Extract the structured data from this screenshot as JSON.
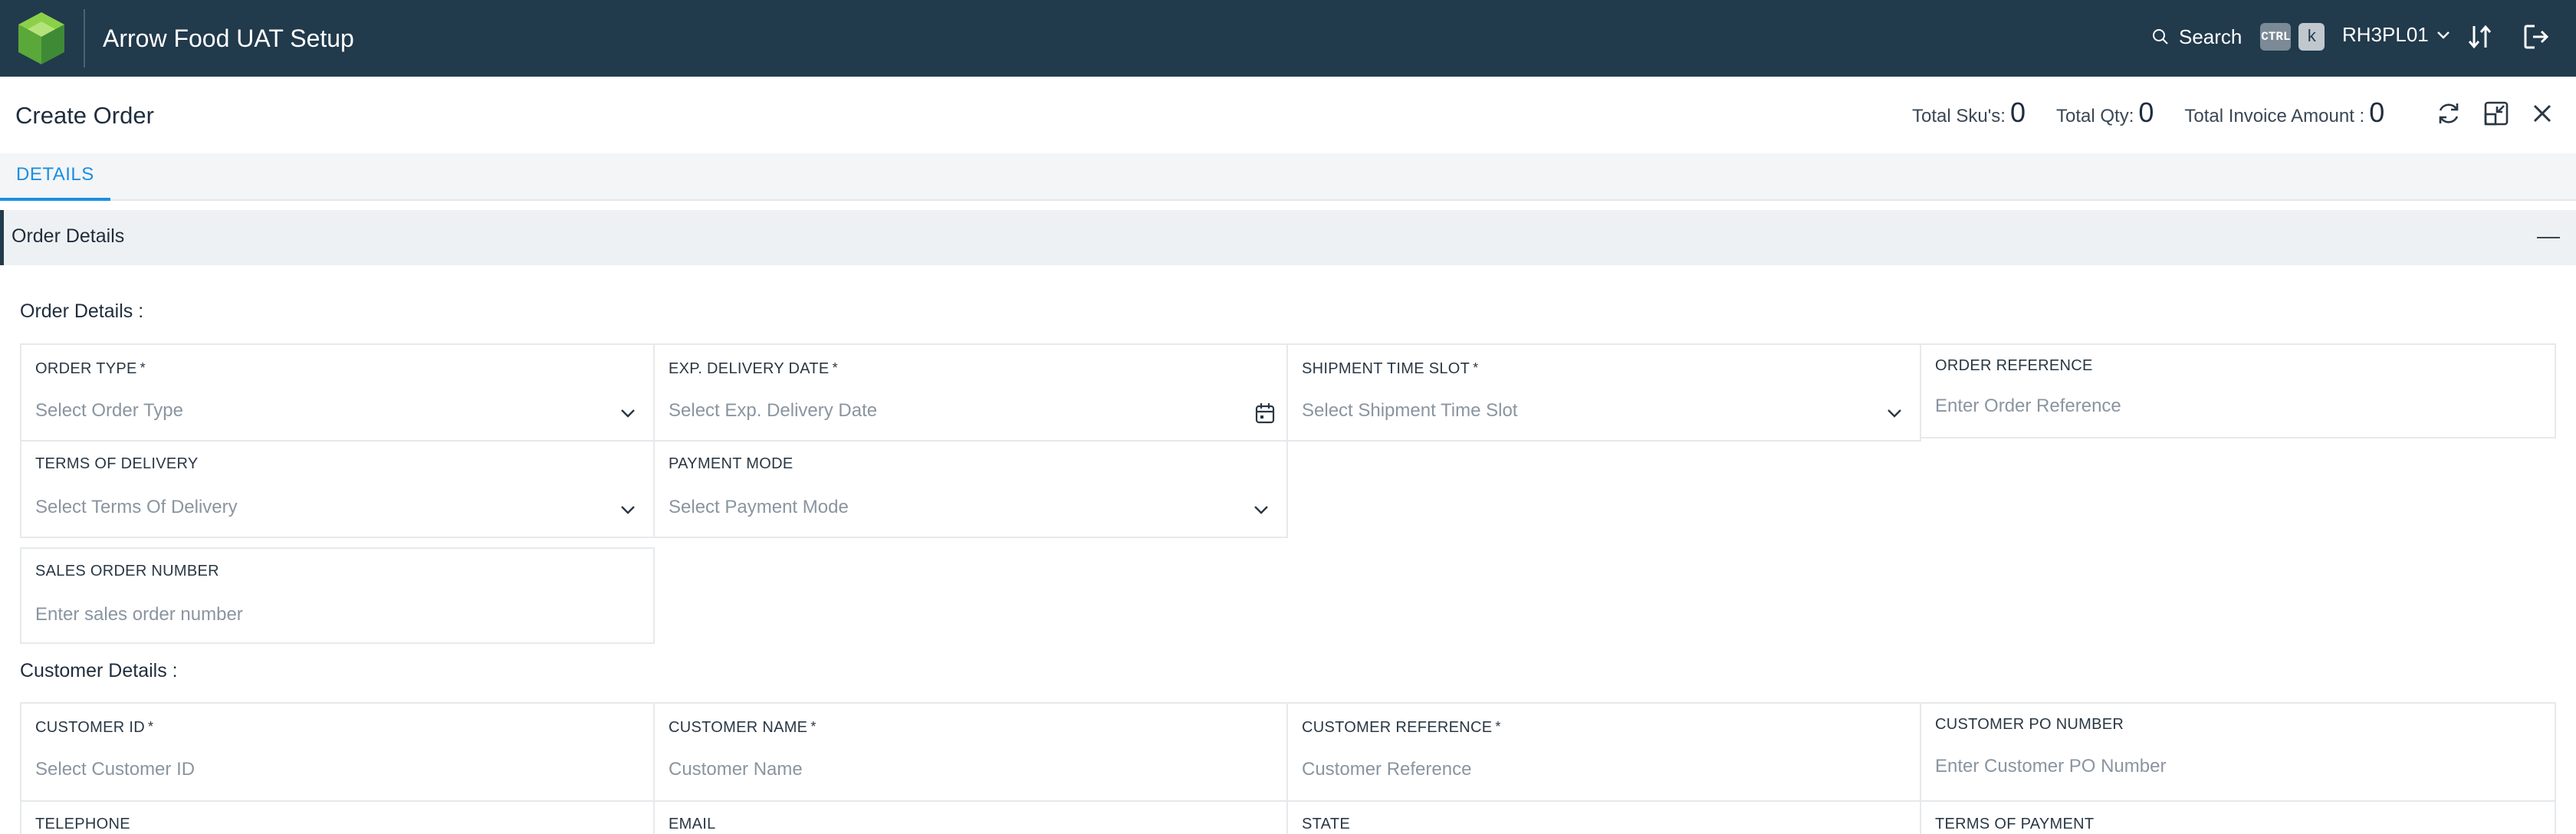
{
  "app": {
    "title": "Arrow Food UAT Setup"
  },
  "topbar": {
    "search_label": "Search",
    "kbd_ctrl": "CTRL",
    "kbd_k": "k",
    "user": "RH3PL01"
  },
  "header": {
    "title": "Create Order",
    "total_skus_label": "Total Sku's:",
    "total_skus_value": "0",
    "total_qty_label": "Total Qty:",
    "total_qty_value": "0",
    "total_invoice_label": "Total Invoice Amount :",
    "total_invoice_value": "0"
  },
  "tabs": [
    {
      "label": "DETAILS",
      "active": true
    }
  ],
  "section": {
    "title": "Order Details"
  },
  "order_details": {
    "title": "Order Details :",
    "fields": [
      {
        "label": "ORDER TYPE",
        "required": "*",
        "placeholder": "Select Order Type"
      },
      {
        "label": "EXP. DELIVERY DATE",
        "required": "*",
        "placeholder": "Select Exp. Delivery Date"
      },
      {
        "label": "SHIPMENT TIME SLOT",
        "required": "*",
        "placeholder": "Select Shipment Time Slot"
      },
      {
        "label": "ORDER REFERENCE",
        "placeholder": "Enter Order Reference"
      },
      {
        "label": "TERMS OF DELIVERY",
        "placeholder": "Select Terms Of Delivery"
      },
      {
        "label": "PAYMENT MODE",
        "placeholder": "Select Payment Mode"
      },
      {
        "label": "SALES ORDER NUMBER",
        "placeholder": "Enter sales order number"
      }
    ]
  },
  "customer_details": {
    "title": "Customer Details :",
    "fields": [
      {
        "label": "CUSTOMER ID",
        "required": "*",
        "placeholder": "Select Customer ID"
      },
      {
        "label": "CUSTOMER NAME",
        "required": "*",
        "placeholder": "Customer Name"
      },
      {
        "label": "CUSTOMER REFERENCE",
        "required": "*",
        "placeholder": "Customer Reference"
      },
      {
        "label": "CUSTOMER PO NUMBER",
        "placeholder": "Enter Customer PO Number"
      },
      {
        "label": "TELEPHONE"
      },
      {
        "label": "EMAIL"
      },
      {
        "label": "STATE"
      },
      {
        "label": "TERMS OF PAYMENT"
      }
    ]
  },
  "colors": {
    "topbar": "#213a4c",
    "accent": "#1a8fe3",
    "logo_green": "#7dc242"
  },
  "icons": [
    "app-logo",
    "search-icon",
    "chevron-down-icon",
    "sort-icon",
    "logout-icon",
    "refresh-icon",
    "minimize-window-icon",
    "close-icon",
    "calendar-icon",
    "collapse-icon"
  ]
}
